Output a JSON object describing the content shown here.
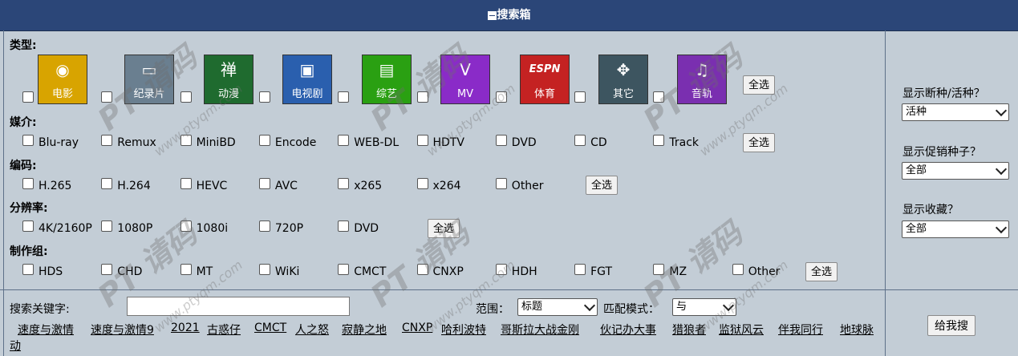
{
  "title": "搜索箱",
  "sections": {
    "type_label": "类型:",
    "media_label": "媒介:",
    "codec_label": "编码:",
    "resolution_label": "分辨率:",
    "group_label": "制作组:"
  },
  "categories": [
    {
      "label": "电影",
      "symbol": "◉",
      "bg": "#d8a400"
    },
    {
      "label": "纪录片",
      "symbol": "▭",
      "bg": "#6a7f90"
    },
    {
      "label": "动漫",
      "symbol": "禅",
      "bg": "#1f6b2f"
    },
    {
      "label": "电视剧",
      "symbol": "▣",
      "bg": "#2a5fae"
    },
    {
      "label": "综艺",
      "symbol": "▤",
      "bg": "#2aa012"
    },
    {
      "label": "MV",
      "symbol": "V",
      "bg": "#8a2bc8"
    },
    {
      "label": "体育",
      "symbol": "ESPN",
      "bg": "#c42222"
    },
    {
      "label": "其它",
      "symbol": "✥",
      "bg": "#3d5560"
    },
    {
      "label": "音轨",
      "symbol": "♫",
      "bg": "#7a2fb0"
    }
  ],
  "select_all": "全选",
  "media": [
    "Blu-ray",
    "Remux",
    "MiniBD",
    "Encode",
    "WEB-DL",
    "HDTV",
    "DVD",
    "CD",
    "Track"
  ],
  "codecs": [
    "H.265",
    "H.264",
    "HEVC",
    "AVC",
    "x265",
    "x264",
    "Other"
  ],
  "resolutions": [
    "4K/2160P",
    "1080P",
    "1080i",
    "720P",
    "DVD"
  ],
  "groups": [
    "HDS",
    "CHD",
    "MT",
    "WiKi",
    "CMCT",
    "CNXP",
    "HDH",
    "FGT",
    "MZ",
    "Other"
  ],
  "right_panel": {
    "dead_label": "显示断种/活种？",
    "dead_value": "活种",
    "promo_label": "显示促销种子？",
    "promo_value": "全部",
    "fav_label": "显示收藏？",
    "fav_value": "全部"
  },
  "search": {
    "keyword_label": "搜索关键字:",
    "keyword_value": "",
    "scope_label": "范围：",
    "scope_value": "标题",
    "match_label": "匹配模式：",
    "match_value": "与",
    "submit_label": "给我搜"
  },
  "hot_searches": [
    "速度与激情",
    "速度与激情9",
    "2021",
    "古惑仔",
    "CMCT",
    "人之怒",
    "寂静之地",
    "CNXP",
    "哈利波特",
    "哥斯拉大战金刚",
    "伙记办大事",
    "猎狼者",
    "监狱风云",
    "伴我同行",
    "地球脉",
    "动"
  ],
  "watermark": {
    "brand": "PT",
    "text": "请码",
    "url": "www.ptyqm.com"
  }
}
